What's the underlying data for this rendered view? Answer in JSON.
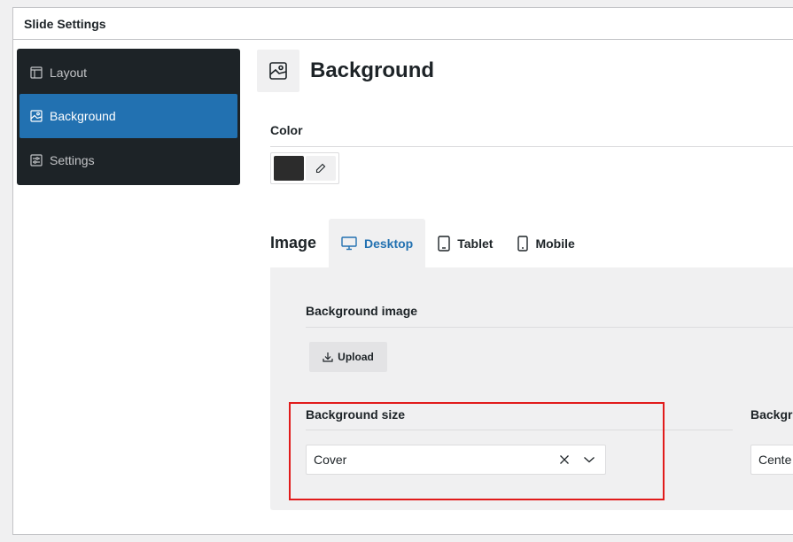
{
  "panel": {
    "title": "Slide Settings"
  },
  "sidebar": {
    "items": [
      {
        "label": "Layout",
        "icon": "layout-icon",
        "active": false
      },
      {
        "label": "Background",
        "icon": "background-icon",
        "active": true
      },
      {
        "label": "Settings",
        "icon": "settings-icon",
        "active": false
      }
    ]
  },
  "section": {
    "title": "Background"
  },
  "color": {
    "label": "Color",
    "swatch": "#2c2c2c"
  },
  "image": {
    "label": "Image",
    "tabs": [
      {
        "label": "Desktop",
        "icon": "desktop-icon",
        "active": true
      },
      {
        "label": "Tablet",
        "icon": "tablet-icon",
        "active": false
      },
      {
        "label": "Mobile",
        "icon": "mobile-icon",
        "active": false
      }
    ],
    "background_image_label": "Background image",
    "upload_label": "Upload",
    "size_label": "Background size",
    "size_value": "Cover",
    "position_label": "Backgro",
    "position_value": "Cente"
  },
  "colors": {
    "accent": "#2271b1",
    "sidebar_bg": "#1d2327",
    "highlight": "#e11b1b"
  }
}
